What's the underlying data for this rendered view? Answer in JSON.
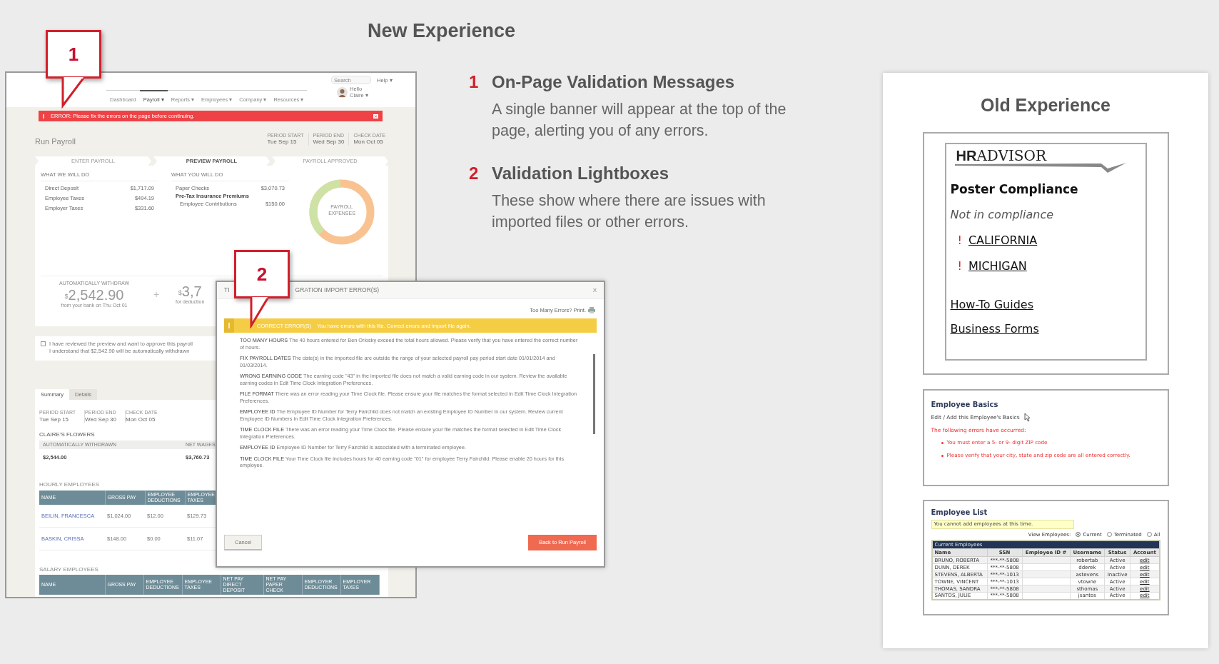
{
  "heading": "New Experience",
  "new_experience": {
    "callouts": [
      {
        "number": "1"
      },
      {
        "number": "2"
      }
    ],
    "app_screen": {
      "nav": [
        {
          "label": "Dashboard",
          "selected": false
        },
        {
          "label": "Payroll ▾",
          "selected": true
        },
        {
          "label": "Reports ▾",
          "selected": false
        },
        {
          "label": "Employees ▾",
          "selected": false
        },
        {
          "label": "Company ▾",
          "selected": false
        },
        {
          "label": "Resources ▾",
          "selected": false
        }
      ],
      "search": {
        "placeholder": "Search"
      },
      "help": "Help ▾",
      "greeting": "Hello",
      "user": "Claire ▾",
      "error_banner": {
        "message": "ERROR:  Please fix the errors on the page before continuing."
      },
      "page_title": "Run Payroll",
      "dates": [
        {
          "label": "PERIOD START",
          "value": "Tue Sep 15"
        },
        {
          "label": "PERIOD END",
          "value": "Wed Sep 30"
        },
        {
          "label": "CHECK DATE",
          "value": "Mon Oct 05"
        }
      ],
      "steps": [
        {
          "label": "ENTER PAYROLL",
          "selected": false
        },
        {
          "label": "PREVIEW PAYROLL",
          "selected": true
        },
        {
          "label": "PAYROLL APPROVED",
          "selected": false
        }
      ],
      "we_will_do": {
        "title": "WHAT WE WILL DO",
        "rows": [
          {
            "kind": "item",
            "label": "Direct Deposit",
            "amount": "$1,717.09"
          },
          {
            "kind": "item",
            "label": "Employee Taxes",
            "amount": "$494.19"
          },
          {
            "kind": "item",
            "label": "Employer Taxes",
            "amount": "$331.60"
          }
        ]
      },
      "you_will_do": {
        "title": "WHAT YOU WILL DO",
        "rows": [
          {
            "kind": "item",
            "label": "Paper Checks",
            "amount": "$3,070.73"
          },
          {
            "kind": "group",
            "label": "Pre-Tax Insurance Premiums"
          },
          {
            "kind": "subitem",
            "label": "Employee Contributions",
            "amount": "$150.00"
          }
        ]
      },
      "donut_label": "PAYROLL EXPENSES",
      "withdraw": {
        "label": "AUTOMATICALLY WITHDRAW",
        "currency": "$",
        "amount": "2,542.90",
        "note": "from your bank on Thu Oct 01"
      },
      "plus": "+",
      "deduction": {
        "currency": "$",
        "amount": "3,7",
        "note": "for deduction"
      },
      "approval": {
        "checked": false,
        "lines": [
          "I have reviewed the preview and want to approve this payroll",
          "I understand that $2,542.90 will be automatically withdrawn"
        ]
      },
      "tabs": [
        {
          "label": "Summary",
          "selected": true
        },
        {
          "label": "Details",
          "selected": false
        }
      ],
      "summary_dates": [
        {
          "label": "PERIOD START",
          "value": "Tue Sep 15"
        },
        {
          "label": "PERIOD END",
          "value": "Wed Sep 30"
        },
        {
          "label": "CHECK DATE",
          "value": "Mon Oct 05"
        }
      ],
      "company": "CLAIRE'S FLOWERS",
      "totals": {
        "columns": [
          "AUTOMATICALLY WITHDRAWN",
          "NET WAGES"
        ],
        "values": [
          "$2,544.00",
          "$3,760.73"
        ]
      },
      "hourly": {
        "title": "HOURLY EMPLOYEES",
        "columns": [
          "NAME",
          "GROSS PAY",
          "EMPLOYEE DEDUCTIONS",
          "EMPLOYEE TAXES"
        ],
        "rows": [
          [
            "BEILIN, FRANCESCA",
            "$1,024.00",
            "$12.00",
            "$129.73"
          ],
          [
            "BASKIN, CRISSA",
            "$148.00",
            "$0.00",
            "$11.07"
          ]
        ]
      },
      "salary": {
        "title": "SALARY EMPLOYEES",
        "columns": [
          "NAME",
          "GROSS PAY",
          "EMPLOYEE DEDUCTIONS",
          "EMPLOYEE TAXES",
          "NET PAY DIRECT DEPOSIT",
          "NET PAY PAPER CHECK",
          "EMPLOYER DEDUCTIONS",
          "EMPLOYER TAXES"
        ]
      }
    },
    "dialog": {
      "title_parts": [
        "TI",
        "GRATION IMPORT ERROR(S)"
      ],
      "close": "X",
      "print_label": "Too Many Errors? Print.",
      "banner": {
        "label": "CORRECT ERROR(S)",
        "message": "You have errors with this file. Correct errors and import file again."
      },
      "errors": [
        "**TOO MANY HOURS**  The 40 hours entered for Ben Orlosky exceed the total hours allowed. Please verify that you have entered the correct number of hours.",
        "**FIX PAYROLL DATES**  The date(s) in the imported file are outside the range of your selected payroll pay period start date 01/01/2014 and 01/03/2014.",
        "**WRONG EARNING CODE**  The earning code \"43\" in the imported file does not match a valid earning code in our system. Review the available earning codes in Edit Time Clock Integration Preferences.",
        "**FILE FORMAT**  There was an error reading your Time Clock file. Please ensure your file matches the format selected in Edit Time Clock Integration Preferences.",
        "**EMPLOYEE ID**  The Employee ID Number for Terry Fairchild does not match an existing Employee ID Number in our system. Review current Employee ID Numbers in Edit Time Clock Integration Preferences.",
        "**TIME CLOCK FILE**  There was an error reading your Time Clock file. Please ensure your file matches the format selected in Edit Time Clock Integration Preferences.",
        "**EMPLOYEE ID**  Employee ID Number for Terry Fairchild is associated with a terminated employee.",
        "**TIME CLOCK FILE**  Your Time Clock file includes hours for 40 earning code \"01\" for employee Terry Fairchild. Please enable 20 hours for this employee."
      ],
      "buttons": [
        {
          "kind": "secondary",
          "label": "Cancel"
        },
        {
          "kind": "primary",
          "label": "Back to Run Payroll"
        }
      ]
    }
  },
  "points": [
    {
      "number": "1",
      "title": "On-Page Validation Messages",
      "text": "A single banner will appear at the top of the page, alerting you of any errors."
    },
    {
      "number": "2",
      "title": "Validation Lightboxes",
      "text": "These show where there are issues with imported files or other errors."
    }
  ],
  "old_experience": {
    "title": "Old Experience",
    "hr_advisor": {
      "logo": "**HR**ADVISOR",
      "title": "Poster Compliance",
      "status": "Not in compliance",
      "states": [
        {
          "mark": "!",
          "name": "CALIFORNIA"
        },
        {
          "mark": "!",
          "name": "MICHIGAN"
        }
      ],
      "links": [
        "How-To Guides",
        "Business Forms"
      ]
    },
    "employee_basics": {
      "title": "Employee Basics",
      "subtitle": "Edit / Add this Employee's Basics",
      "error_title": "The following errors have occurred:",
      "errors": [
        "You must enter a 5- or 9- digit ZIP code",
        "Please verify that your city, state and zip code are all entered correctly."
      ]
    },
    "employee_list": {
      "title": "Employee List",
      "notice": "You cannot add employees at this time.",
      "filter_label": "View Employees:",
      "filters": [
        {
          "label": "Current",
          "selected": true
        },
        {
          "label": "Terminated",
          "selected": false
        },
        {
          "label": "All",
          "selected": false
        }
      ],
      "table_title": "Current Employees",
      "columns": [
        "Name",
        "SSN",
        "Employee ID #",
        "Username",
        "Status",
        "Account"
      ],
      "rows": [
        {
          "name": "BRUNO, ROBERTA",
          "ssn": "***-**-5808",
          "username": "robertab",
          "status": "Active",
          "account": "edit"
        },
        {
          "name": "DUNN, DEREK",
          "ssn": "***-**-5808",
          "username": "dderek",
          "status": "Active",
          "account": "edit"
        },
        {
          "name": "STEVENS, ALBERTA",
          "ssn": "***-**-1013",
          "username": "astevens",
          "status": "Inactive",
          "account": "edit"
        },
        {
          "name": "TOWNE, VINCENT",
          "ssn": "***-**-1013",
          "username": "vtowne",
          "status": "Active",
          "account": "edit"
        },
        {
          "name": "THOMAS, SANDRA",
          "ssn": "***-**-5808",
          "username": "sthomas",
          "status": "Active",
          "account": "edit"
        },
        {
          "name": "SANTOS, JULIE",
          "ssn": "***-**-5808",
          "username": "jsantos",
          "status": "Active",
          "account": "edit"
        }
      ]
    }
  }
}
